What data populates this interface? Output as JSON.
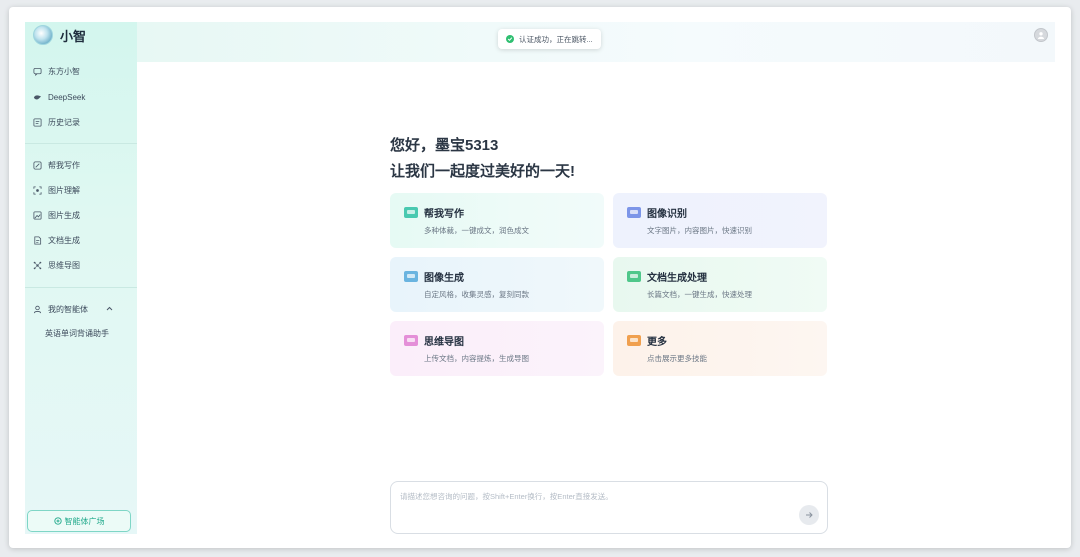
{
  "app": {
    "name": "小智"
  },
  "sidebar": {
    "top_items": [
      {
        "label": "东方小智",
        "icon": "chat-icon"
      },
      {
        "label": "DeepSeek",
        "icon": "deepseek-icon"
      },
      {
        "label": "历史记录",
        "icon": "history-icon"
      }
    ],
    "tool_items": [
      {
        "label": "帮我写作",
        "icon": "write-icon"
      },
      {
        "label": "图片理解",
        "icon": "image-scan-icon"
      },
      {
        "label": "图片生成",
        "icon": "image-icon"
      },
      {
        "label": "文档生成",
        "icon": "document-icon"
      },
      {
        "label": "思维导图",
        "icon": "mindmap-icon"
      }
    ],
    "agents": {
      "label": "我的智能体",
      "items": [
        "英语单词背诵助手"
      ]
    },
    "square_button": "智能体广场"
  },
  "toast": {
    "text": "认证成功，正在跳转..."
  },
  "greeting": {
    "line1": "您好，墨宝5313",
    "line2": "让我们一起度过美好的一天!"
  },
  "cards": {
    "write": {
      "title": "帮我写作",
      "desc": "多种体裁，一键成文，润色成文",
      "color": "#49c9b0"
    },
    "recognize": {
      "title": "图像识别",
      "desc": "文字图片，内容图片，快速识别",
      "color": "#7c95e8"
    },
    "generate": {
      "title": "图像生成",
      "desc": "自定风格，收集灵感，复刻同款",
      "color": "#6ab4e0"
    },
    "document": {
      "title": "文档生成处理",
      "desc": "长篇文档，一键生成，快速处理",
      "color": "#4fc78a"
    },
    "mindmap": {
      "title": "思维导图",
      "desc": "上传文档，内容提炼，生成导图",
      "color": "#e48fd8"
    },
    "more": {
      "title": "更多",
      "desc": "点击展示更多技能",
      "color": "#f0a04f"
    }
  },
  "input": {
    "placeholder": "请描述您想咨询的问题，按Shift+Enter换行，按Enter直接发送。"
  }
}
